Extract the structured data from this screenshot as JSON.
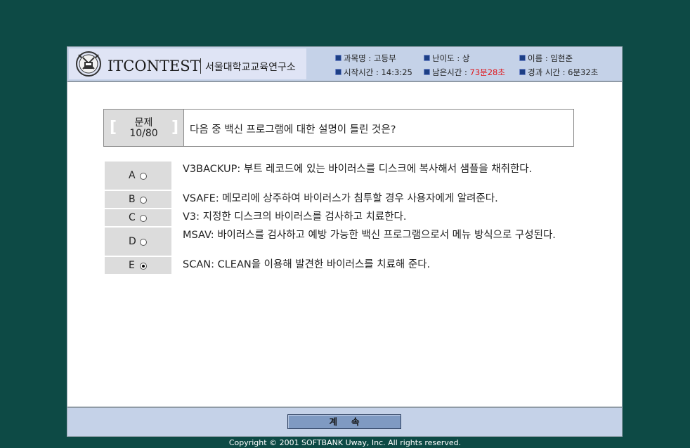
{
  "header": {
    "brand": "ITCONTEST",
    "institute": "서울대학교교육연구소",
    "subject": "과목명 : 고등부",
    "difficulty": "난이도 : 상",
    "name": "이름 : 임현준",
    "start_time": "시작시간 : 14:3:25",
    "remaining_label": "남은시간 : ",
    "remaining_value": "73분28초",
    "elapsed": "경과 시간 : 6분32초"
  },
  "question": {
    "number_label": "문제",
    "number_value": "10/80",
    "text": "다음 중 백신 프로그램에 대한 설명이 틀린 것은?"
  },
  "options": [
    {
      "letter": "A",
      "text": "V3BACKUP: 부트 레코드에 있는 바이러스를 디스크에 복사해서 샘플을 채취한다.",
      "selected": false
    },
    {
      "letter": "B",
      "text": "VSAFE: 메모리에 상주하여 바이러스가 침투할 경우 사용자에게 알려준다.",
      "selected": false
    },
    {
      "letter": "C",
      "text": "V3: 지정한 디스크의 바이러스를 검사하고 치료한다.",
      "selected": false
    },
    {
      "letter": "D",
      "text": "MSAV: 바이러스를 검사하고 예방 가능한 백신 프로그램으로서 메뉴 방식으로 구성된다.",
      "selected": false
    },
    {
      "letter": "E",
      "text": "SCAN: CLEAN을 이용해 발견한 바이러스를 치료해 준다.",
      "selected": true
    }
  ],
  "footer": {
    "continue_label": "계속"
  },
  "copyright": "Copyright © 2001 SOFTBANK Uway, Inc. All rights reserved.",
  "colors": {
    "background": "#0d4a45",
    "header": "#c5d2e8",
    "remaining_time": "#e0161b",
    "button": "#7f9ac2"
  }
}
